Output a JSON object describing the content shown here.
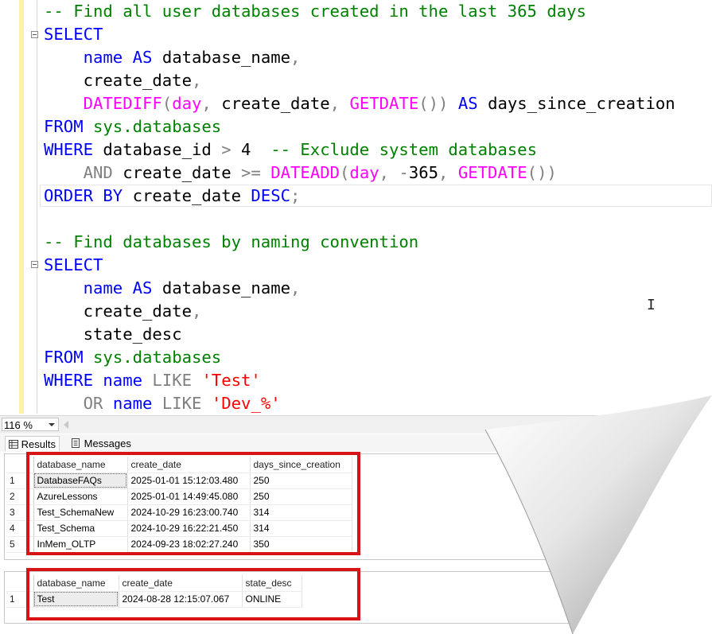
{
  "editor": {
    "lines": [
      [
        "-- Find all user databases created in the last 365 days"
      ],
      [
        "SELECT"
      ],
      [
        "    name AS database_name,"
      ],
      [
        "    create_date,"
      ],
      [
        "    DATEDIFF(day, create_date, GETDATE()) AS days_since_creation"
      ],
      [
        "FROM sys.databases"
      ],
      [
        "WHERE database_id > 4  -- Exclude system databases"
      ],
      [
        "    AND create_date >= DATEADD(day, -365, GETDATE())"
      ],
      [
        "ORDER BY create_date DESC;"
      ],
      [
        ""
      ],
      [
        "-- Find databases by naming convention"
      ],
      [
        "SELECT"
      ],
      [
        "    name AS database_name,"
      ],
      [
        "    create_date,"
      ],
      [
        "    state_desc"
      ],
      [
        "FROM sys.databases"
      ],
      [
        "WHERE name LIKE 'Test'"
      ],
      [
        "    OR name LIKE 'Dev_%'"
      ]
    ]
  },
  "zoom": {
    "value": "116 %"
  },
  "tabs": {
    "results": "Results",
    "messages": "Messages"
  },
  "grid1": {
    "columns": [
      "database_name",
      "create_date",
      "days_since_creation"
    ],
    "rows": [
      [
        "1",
        "DatabaseFAQs",
        "2025-01-01 15:12:03.480",
        "250"
      ],
      [
        "2",
        "AzureLessons",
        "2025-01-01 14:49:45.080",
        "250"
      ],
      [
        "3",
        "Test_SchemaNew",
        "2024-10-29 16:23:00.740",
        "314"
      ],
      [
        "4",
        "Test_Schema",
        "2024-10-29 16:22:21.450",
        "314"
      ],
      [
        "5",
        "InMem_OLTP",
        "2024-09-23 18:02:27.240",
        "350"
      ]
    ]
  },
  "grid2": {
    "columns": [
      "database_name",
      "create_date",
      "state_desc"
    ],
    "rows": [
      [
        "1",
        "Test",
        "2024-08-28 12:15:07.067",
        "ONLINE"
      ]
    ]
  },
  "colors": {
    "highlight": "#d81313",
    "keyword": "#0000ff",
    "comment": "#008000",
    "function": "#ff00ff",
    "string": "#ff0000"
  }
}
